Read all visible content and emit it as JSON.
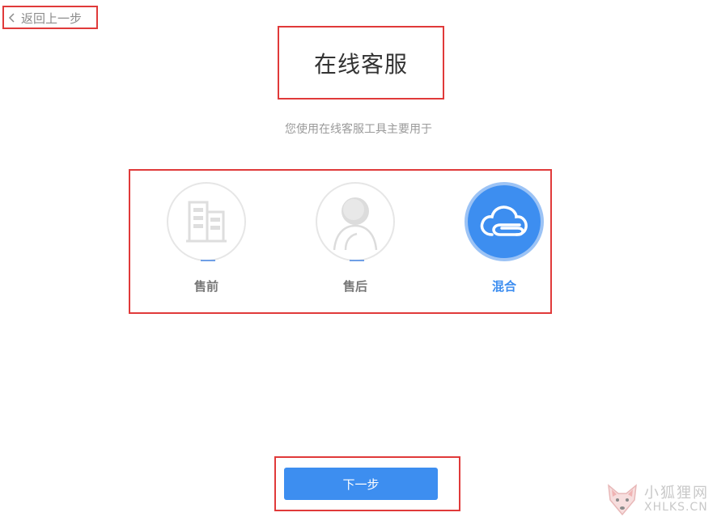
{
  "nav": {
    "back_label": "返回上一步"
  },
  "header": {
    "title": "在线客服",
    "subtitle": "您使用在线客服工具主要用于"
  },
  "options": [
    {
      "label": "售前",
      "icon": "building-icon",
      "selected": false
    },
    {
      "label": "售后",
      "icon": "user-icon",
      "selected": false
    },
    {
      "label": "混合",
      "icon": "cloud-icon",
      "selected": true
    }
  ],
  "footer": {
    "next_label": "下一步"
  },
  "watermark": {
    "cn": "小狐狸网",
    "en": "XHLKS.CN",
    "logo": "fox-logo"
  },
  "colors": {
    "accent": "#3d8ef0",
    "highlight_box": "#e03a3a",
    "muted_text": "#9a9a9a"
  }
}
